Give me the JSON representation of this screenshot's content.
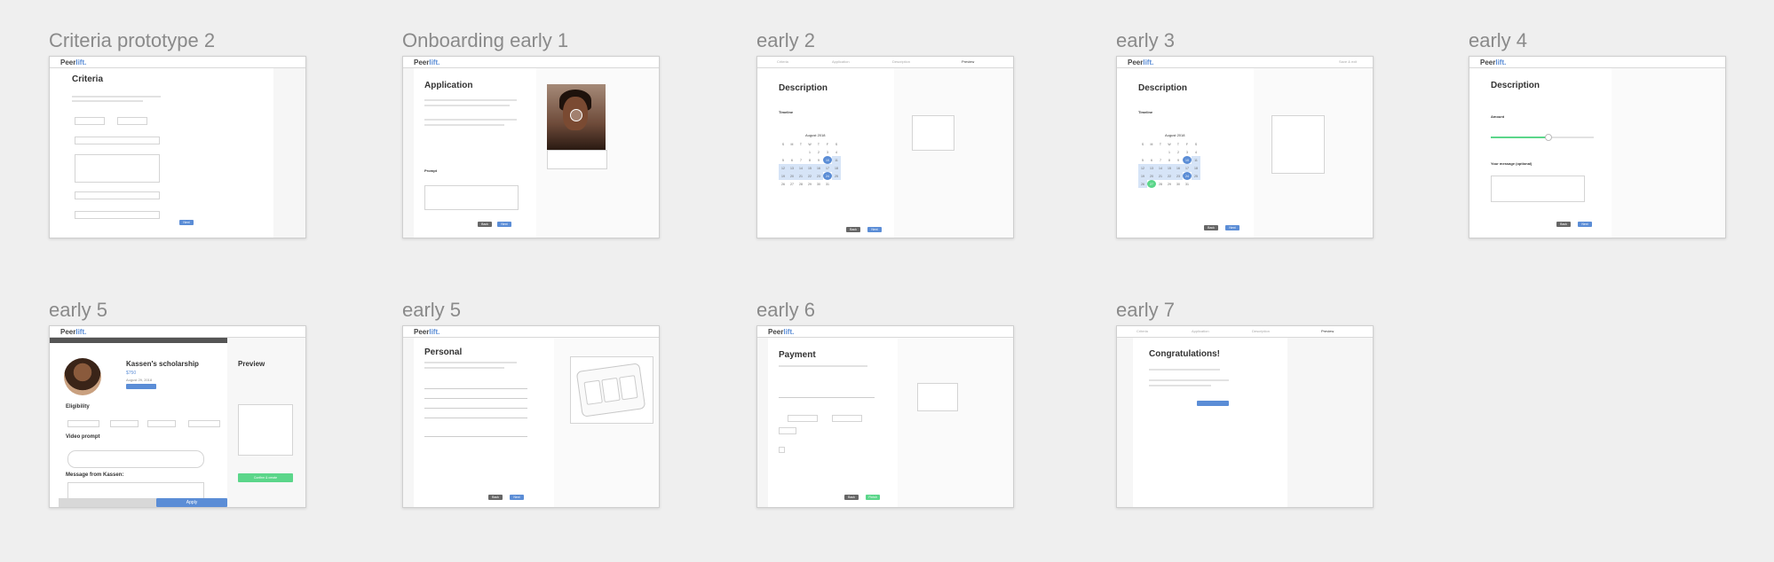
{
  "artboards": [
    {
      "title": "Criteria prototype 2",
      "heading": "Criteria"
    },
    {
      "title": "Onboarding early 1",
      "heading": "Application",
      "prompt_label": "Prompt"
    },
    {
      "title": "early 2",
      "heading": "Description",
      "timeline_label": "Timeline",
      "month": "August 2018",
      "tabs": [
        "Criteria",
        "Application",
        "Description",
        "Preview"
      ]
    },
    {
      "title": "early 3",
      "heading": "Description",
      "timeline_label": "Timeline",
      "month": "August 2018",
      "save_label": "Save & exit"
    },
    {
      "title": "early 4",
      "heading": "Description",
      "amount_label": "Amount",
      "message_label": "Your message (optional)",
      "slider_fraction": 0.55
    },
    {
      "title": "early 5",
      "heading": "Kassen's scholarship",
      "amount": "$750",
      "date": "August 29, 2018",
      "eligibility_label": "Eligibility",
      "video_label": "Video prompt",
      "message_label": "Message from Kassen:",
      "preview_label": "Preview",
      "apply_label": "Apply",
      "cta_label": "Confirm & create"
    },
    {
      "title": "early 5",
      "heading": "Personal"
    },
    {
      "title": "early 6",
      "heading": "Payment",
      "finish_label": "Finish"
    },
    {
      "title": "early 7",
      "heading": "Congratulations!",
      "tabs": [
        "Criteria",
        "Application",
        "Description",
        "Preview"
      ]
    }
  ],
  "brand": {
    "peer": "Peer",
    "lift": "lift."
  },
  "buttons": {
    "back": "Back",
    "next": "Next"
  },
  "colors": {
    "accent": "#5b8dd6",
    "success": "#5bd68a",
    "background": "#efefef"
  }
}
